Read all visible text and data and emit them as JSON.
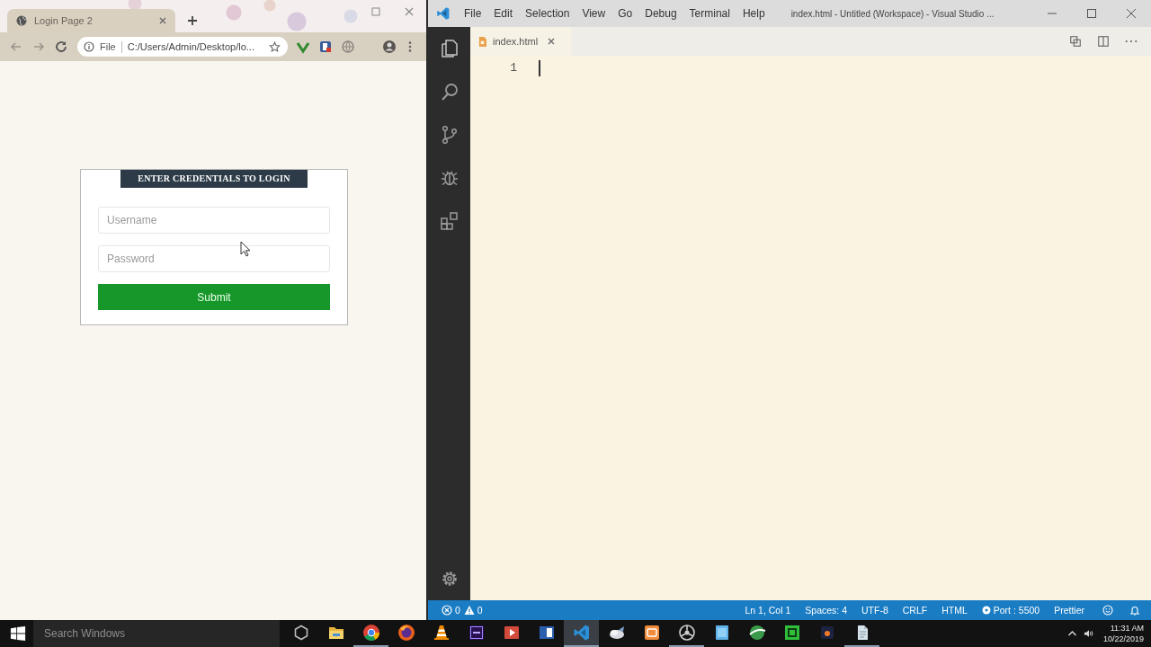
{
  "browser": {
    "tab": {
      "title": "Login Page 2"
    },
    "address_bar": {
      "scheme": "File",
      "url": "C:/Users/Admin/Desktop/lo..."
    }
  },
  "login_form": {
    "heading": "ENTER CREDENTIALS TO LOGIN",
    "fields": [
      {
        "placeholder": "Username"
      },
      {
        "placeholder": "Password"
      }
    ],
    "submit": "Submit"
  },
  "editor": {
    "menu": [
      "File",
      "Edit",
      "Selection",
      "View",
      "Go",
      "Debug",
      "Terminal",
      "Help"
    ],
    "title": "index.html - Untitled (Workspace) - Visual Studio ...",
    "tabs": [
      {
        "label": "index.html",
        "selected": true
      }
    ],
    "line_numbers": [
      "1"
    ]
  },
  "status_bar": {
    "errors": "0",
    "warnings": "0",
    "items": [
      {
        "kind": "text",
        "label": "Ln 1, Col 1"
      },
      {
        "kind": "text",
        "label": "Spaces: 4"
      },
      {
        "kind": "text",
        "label": "UTF-8"
      },
      {
        "kind": "text",
        "label": "CRLF"
      },
      {
        "kind": "text",
        "label": "HTML"
      },
      {
        "kind": "server",
        "label": "Port : 5500"
      },
      {
        "kind": "text",
        "label": "Prettier"
      }
    ]
  },
  "taskbar": {
    "search": {
      "placeholder": "Search Windows"
    },
    "apps": [
      {
        "running": false,
        "selected": false
      },
      {
        "running": true,
        "selected": false
      },
      {
        "running": false,
        "selected": false
      },
      {
        "running": false,
        "selected": false
      },
      {
        "running": false,
        "selected": false
      },
      {
        "running": false,
        "selected": false
      },
      {
        "running": false,
        "selected": false
      },
      {
        "running": true,
        "selected": true
      },
      {
        "running": false,
        "selected": false
      },
      {
        "running": false,
        "selected": false
      },
      {
        "running": true,
        "selected": false
      },
      {
        "running": false,
        "selected": false
      },
      {
        "running": false,
        "selected": false
      },
      {
        "running": false,
        "selected": false
      },
      {
        "running": false,
        "selected": false
      },
      {
        "running": true,
        "selected": false
      }
    ],
    "clock": {
      "time": "11:31 AM",
      "date": "10/22/2019"
    }
  }
}
